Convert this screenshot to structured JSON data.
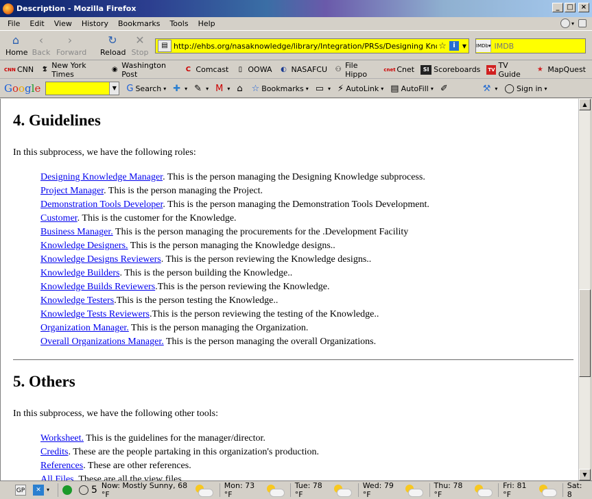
{
  "window": {
    "title": "Description - Mozilla Firefox"
  },
  "menu": [
    "File",
    "Edit",
    "View",
    "History",
    "Bookmarks",
    "Tools",
    "Help"
  ],
  "nav": {
    "home": "Home",
    "back": "Back",
    "forward": "Forward",
    "reload": "Reload",
    "stop": "Stop",
    "url": "http://ehbs.org/nasaknowledge/library/Integration/PRSs/Designing Knowledge",
    "search_placeholder": "IMDB",
    "search_engine": "IMDb"
  },
  "bookmarks": [
    "CNN",
    "New York Times",
    "Washington Post",
    "Comcast",
    "OOWA",
    "NASAFCU",
    "File Hippo",
    "Cnet",
    "Scoreboards",
    "TV Guide",
    "MapQuest"
  ],
  "google_toolbar": {
    "logo": "Google",
    "search": "Search",
    "bookmarks": "Bookmarks",
    "autolink": "AutoLink",
    "autofill": "AutoFill",
    "signin": "Sign in"
  },
  "page": {
    "section4": {
      "heading": "4. Guidelines",
      "intro": "In this subprocess, we have the following roles:",
      "roles": [
        {
          "link": "Designing Knowledge Manager",
          "text": ". This is the person managing the Designing Knowledge subprocess."
        },
        {
          "link": "Project Manager",
          "text": ". This is the person managing the Project."
        },
        {
          "link": "Demonstration Tools Developer",
          "text": ". This is the person managing the Demonstration Tools Development."
        },
        {
          "link": "Customer",
          "text": ". This is the customer for the Knowledge."
        },
        {
          "link": "Business Manager.",
          "text": " This is the person managing the procurements for the .Development Facility"
        },
        {
          "link": "Knowledge Designers.",
          "text": " This is the person managing the Knowledge designs.."
        },
        {
          "link": "Knowledge Designs Reviewers",
          "text": ". This is the person reviewing the Knowledge designs.."
        },
        {
          "link": "Knowledge Builders",
          "text": ". This is the person building the Knowledge.."
        },
        {
          "link": "Knowledge Builds Reviewers",
          "text": ".This is the person reviewing the Knowledge."
        },
        {
          "link": "Knowledge Testers",
          "text": ".This is the person testing the Knowledge.."
        },
        {
          "link": "Knowledge Tests Reviewers",
          "text": ".This is the person reviewing the testing of the Knowledge.."
        },
        {
          "link": "Organization Manager.",
          "text": " This is the person managing the Organization."
        },
        {
          "link": "Overall Organizations Manager.",
          "text": " This is the person managing the overall Organizations."
        }
      ]
    },
    "section5": {
      "heading": "5. Others",
      "intro": "In this subprocess, we have the following other tools:",
      "tools": [
        {
          "link": "Worksheet.",
          "text": " This is the guidelines for the manager/director."
        },
        {
          "link": "Credits",
          "text": ". These are the people partaking in this organization's production."
        },
        {
          "link": "References",
          "text": ". These are other references."
        },
        {
          "link": "All Files",
          "text": ". These are all the view files."
        }
      ]
    }
  },
  "statusbar": {
    "gp": "GP",
    "five": "5",
    "weather": [
      {
        "label": "Now: Mostly Sunny, 68 °F"
      },
      {
        "label": "Mon: 73 °F"
      },
      {
        "label": "Tue: 78 °F"
      },
      {
        "label": "Wed: 79 °F"
      },
      {
        "label": "Thu: 78 °F"
      },
      {
        "label": "Fri: 81 °F"
      },
      {
        "label": "Sat: 8"
      }
    ]
  }
}
